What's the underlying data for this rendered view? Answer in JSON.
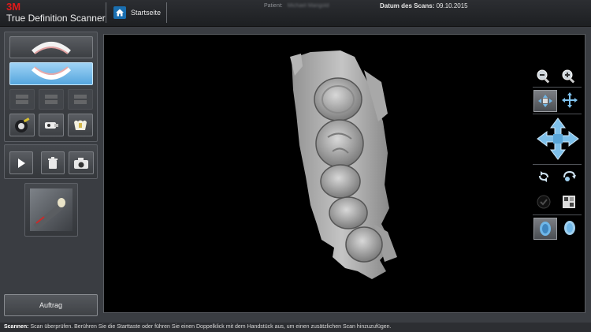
{
  "header": {
    "brand_logo": "3M",
    "brand_name": "True Definition Scanner",
    "home_label": "Startseite",
    "patient_label": "Patient:",
    "patient_value": "Michael Mangold",
    "scan_date_label": "Datum des Scans:",
    "scan_date_value": "09.10.2015"
  },
  "left_panel": {
    "order_button_label": "Auftrag"
  },
  "status": {
    "label": "Scannen:",
    "text": "Scan überprüfen.  Berühren Sie die Starttaste oder führen Sie einen Doppelklick mit dem Handstück aus, um einen zusätzlichen Scan hinzuzufügen."
  },
  "colors": {
    "brand_red": "#e21a1a",
    "active_blue": "#6bb8ea",
    "background": "#3a3d42"
  },
  "icons": {
    "home": "home-icon",
    "zoom_out": "zoom-out-icon",
    "zoom_in": "zoom-in-icon",
    "play": "play-icon",
    "trash": "trash-icon",
    "camera": "camera-icon"
  }
}
